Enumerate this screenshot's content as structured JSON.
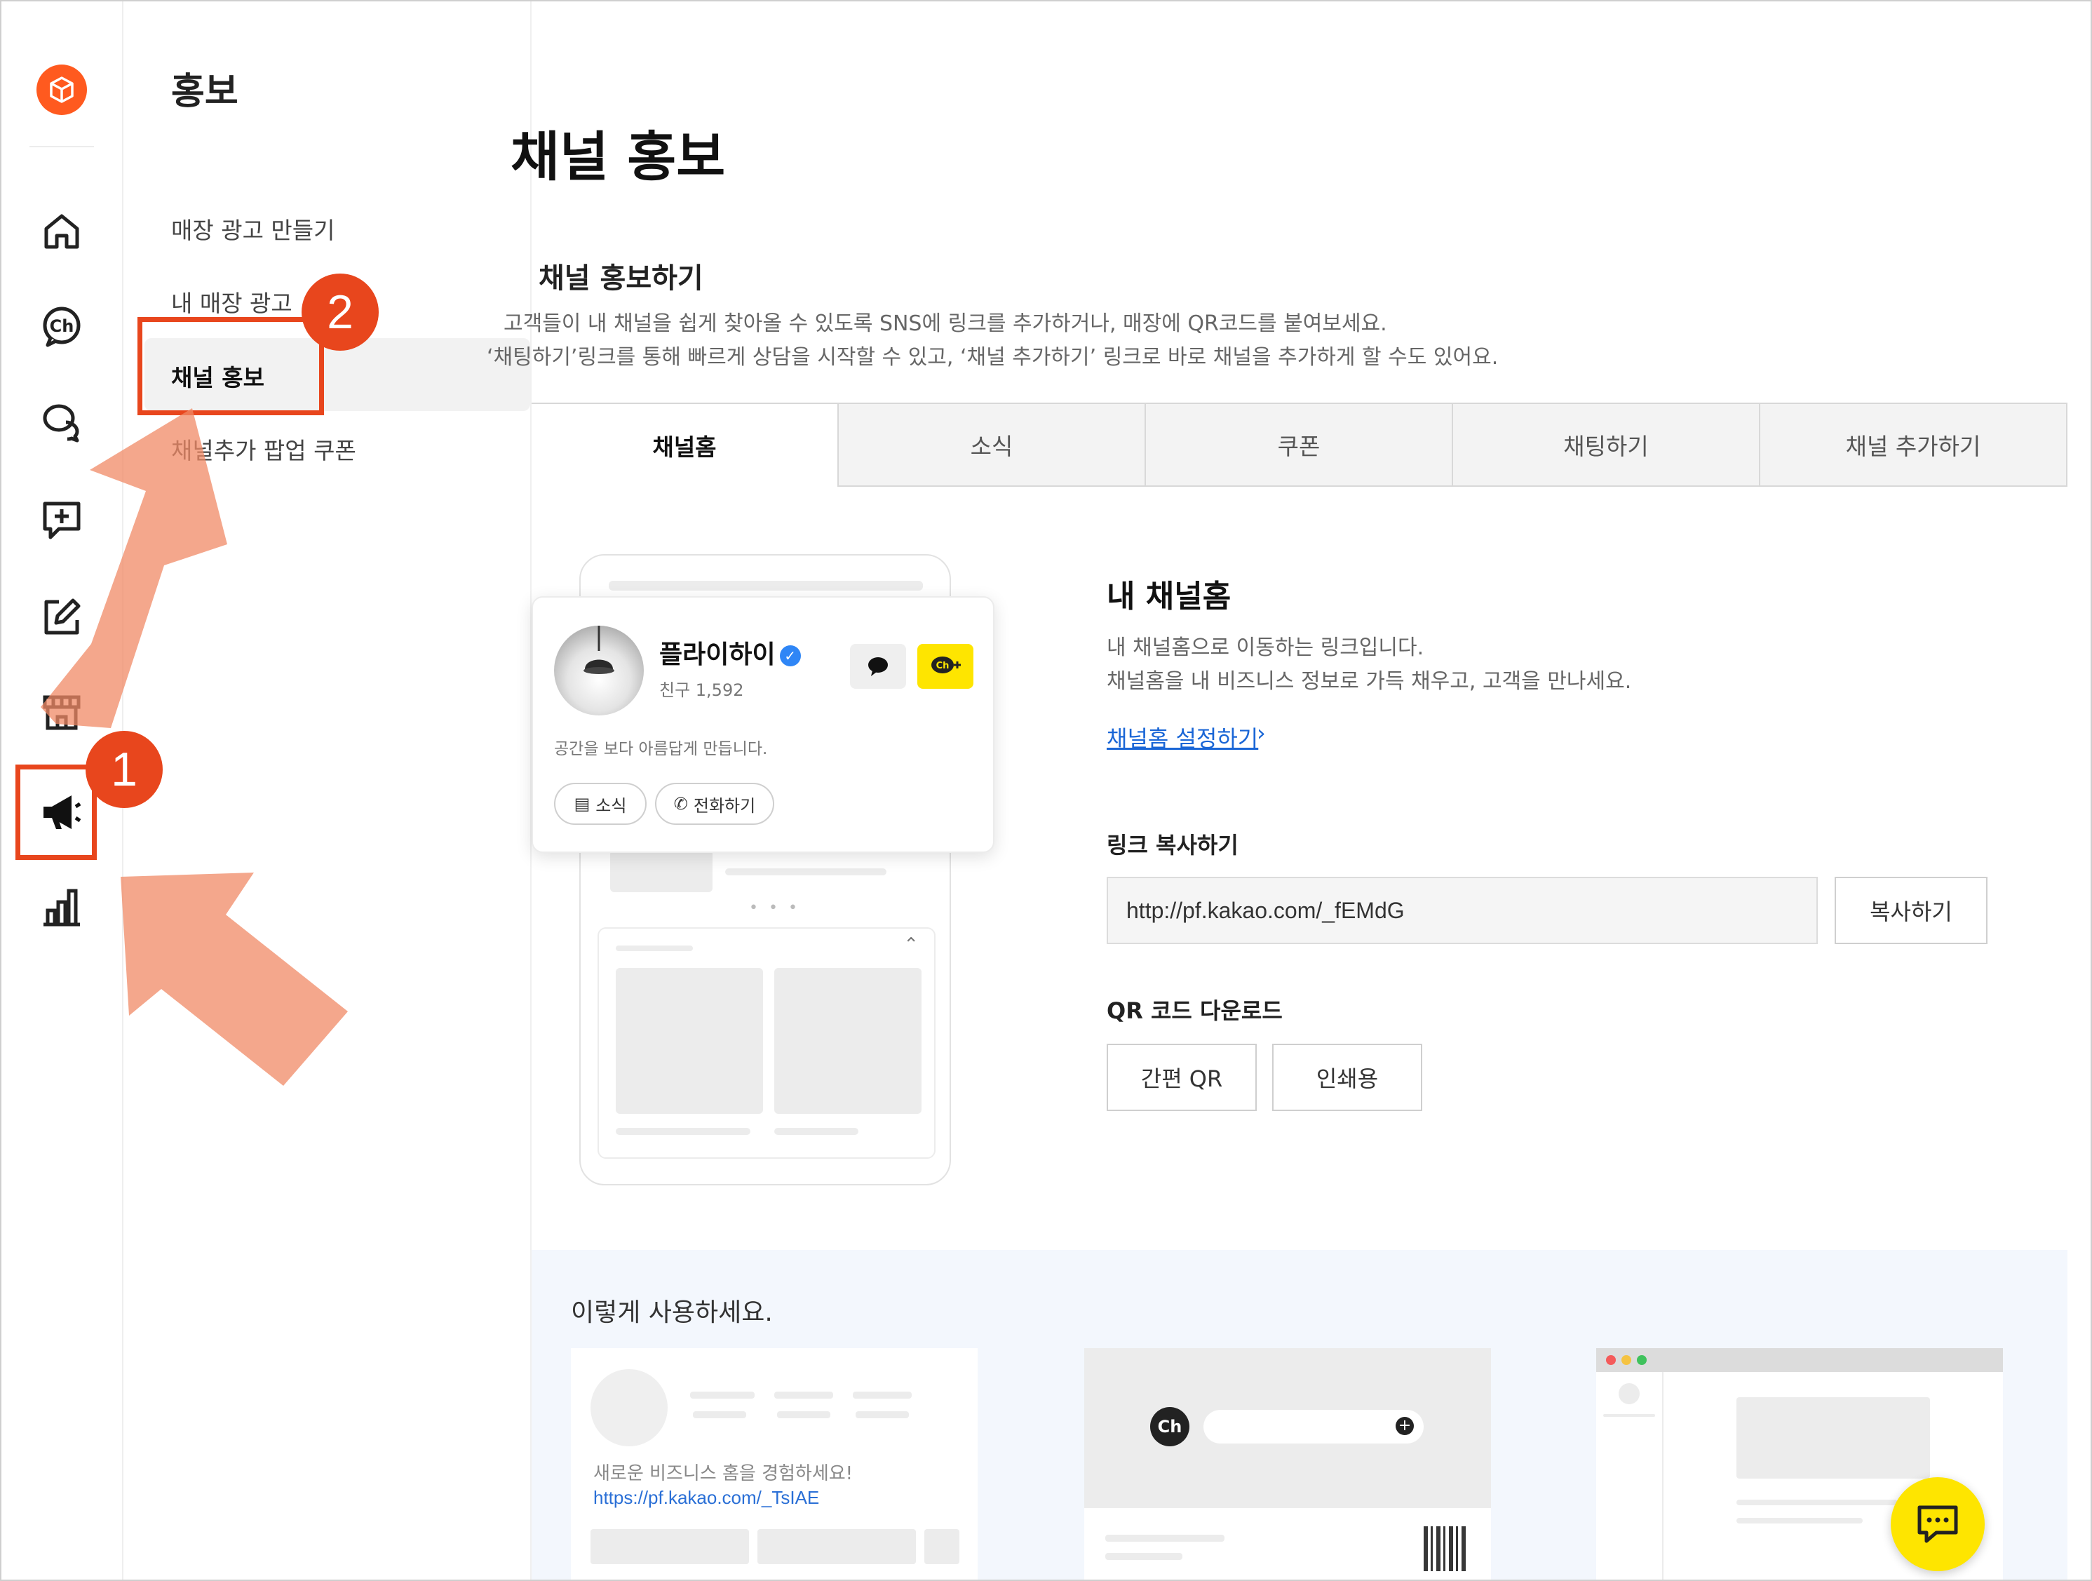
{
  "submenu": {
    "title": "홍보",
    "items": [
      "매장 광고 만들기",
      "내 매장 광고",
      "채널 홍보",
      "채널추가 팝업 쿠폰"
    ]
  },
  "main": {
    "title": "채널 홍보",
    "section_title": "채널 홍보하기",
    "desc1": "고객들이 내 채널을 쉽게 찾아올 수 있도록 SNS에 링크를 추가하거나, 매장에 QR코드를 붙여보세요.",
    "desc2": "‘채팅하기’링크를 통해 빠르게 상담을 시작할 수 있고, ‘채널 추가하기’ 링크로 바로 채널을 추가하게 할 수도 있어요.",
    "tabs": [
      "채널홈",
      "소식",
      "쿠폰",
      "채팅하기",
      "채널 추가하기"
    ]
  },
  "profile_card": {
    "name": "플라이하이",
    "friends": "친구 1,592",
    "description": "공간을 보다 아름답게 만듭니다.",
    "chip_news": "소식",
    "chip_call": "전화하기",
    "ch_plus": "Ch+"
  },
  "detail": {
    "title": "내 채널홈",
    "desc1": "내 채널홈으로 이동하는 링크입니다.",
    "desc2": "채널홈을 내 비즈니스 정보로 가득 채우고, 고객을 만나세요.",
    "settings_link": "채널홈 설정하기",
    "link_label": "링크 복사하기",
    "url": "http://pf.kakao.com/_fEMdG",
    "copy_button": "복사하기",
    "qr_label": "QR 코드 다운로드",
    "qr_simple": "간편 QR",
    "qr_print": "인쇄용"
  },
  "usage": {
    "title": "이렇게 사용하세요.",
    "sample_text": "새로운 비즈니스 홈을 경험하세요!",
    "sample_link": "https://pf.kakao.com/_TsIAE",
    "ch_label": "Ch"
  },
  "badges": [
    "1",
    "2"
  ],
  "colors": {
    "accent": "#e8461d",
    "brand": "#ff5a1f",
    "kakao_yellow": "#fee500",
    "link": "#1a66d6"
  }
}
